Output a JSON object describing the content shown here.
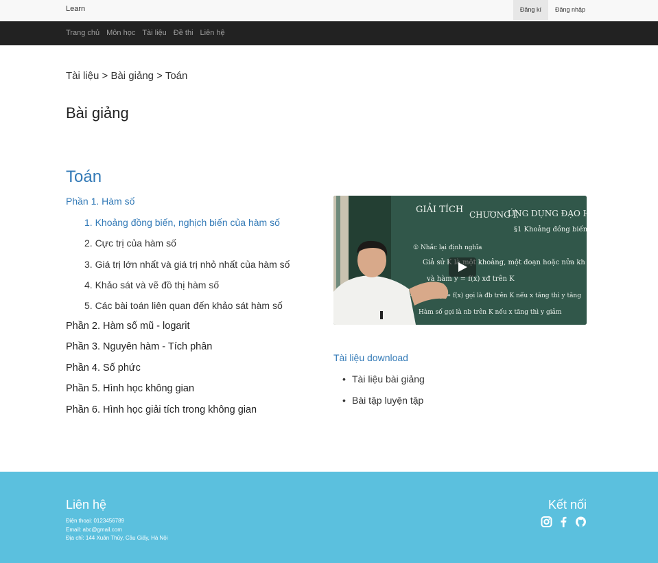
{
  "header": {
    "brand": "Learn",
    "auth": {
      "register": "Đăng kí",
      "login": "Đăng nhập"
    },
    "nav": [
      "Trang chủ",
      "Môn học",
      "Tài liệu",
      "Đề thi",
      "Liên hệ"
    ]
  },
  "main": {
    "breadcrumb": "Tài liệu > Bài giảng > Toán",
    "page_title": "Bài giảng",
    "subject": "Toán",
    "active_section": "Phần 1. Hàm số",
    "lessons": [
      "1. Khoảng đồng biến, nghịch biến của hàm số",
      "2. Cực trị của hàm số",
      "3. Giá trị lớn nhất và giá trị nhỏ nhất của hàm số",
      "4. Khảo sát và vẽ đồ thị hàm số",
      "5. Các bài toán liên quan đến khảo sát hàm số"
    ],
    "sections": [
      "Phần 2. Hàm số mũ - logarit",
      "Phần 3. Nguyên hàm - Tích phân",
      "Phần 4. Số phức",
      "Phần 5. Hình học không gian",
      "Phần 6. Hình học giải tích trong không gian"
    ],
    "video": {
      "board_text": [
        "GIẢI TÍCH",
        "CHƯƠNG I.",
        "ỨNG DỤNG ĐẠO HÀM",
        "§1 Khoảng đồng biến",
        "① Nhắc lại định nghĩa",
        "Giả sử K là một khoảng, một đoạn hoặc nửa kh",
        "và hàm y = f(x) xđ trên K",
        "- Hàm số y = f(x) gọi là đb trên K nếu x tăng thì y tăng",
        "Hàm số gọi là nb trên K nếu x tăng thì y giảm"
      ]
    },
    "download_title": "Tài liệu download",
    "downloads": [
      "Tài liệu bài giảng",
      "Bài tập luyện tập"
    ]
  },
  "footer": {
    "contact_title": "Liên hệ",
    "phone": "Điện thoại: 0123456789",
    "email": "Email: abc@gmail.com",
    "address": "Địa chỉ: 144 Xuân Thủy, Cầu Giấy, Hà Nội",
    "connect_title": "Kết nối",
    "icons": [
      "instagram-icon",
      "facebook-icon",
      "github-icon"
    ]
  },
  "colors": {
    "link": "#337ab7",
    "navbar": "#222222",
    "footer": "#5bc0de"
  }
}
